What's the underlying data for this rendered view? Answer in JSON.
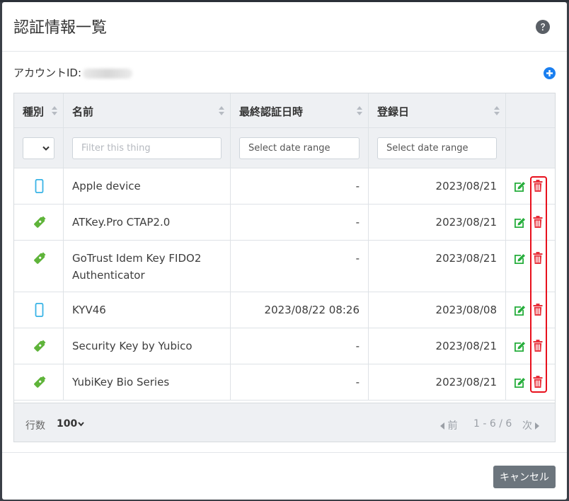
{
  "modal": {
    "title": "認証情報一覧",
    "account_label": "アカウントID:"
  },
  "colors": {
    "accent": "#1a7ff0",
    "edit": "#27ae3d",
    "delete": "#e8303a",
    "device": "#3ab4e6",
    "key": "#5fb43a",
    "highlight": "#e8101c"
  },
  "table": {
    "columns": [
      "種別",
      "名前",
      "最終認証日時",
      "登録日"
    ],
    "filters": {
      "name_placeholder": "Filter this thing",
      "last_auth_placeholder": "Select date range",
      "registered_placeholder": "Select date range"
    },
    "rows": [
      {
        "type": "device",
        "name": "Apple device",
        "last_auth": "-",
        "registered": "2023/08/21"
      },
      {
        "type": "key",
        "name": "ATKey.Pro CTAP2.0",
        "last_auth": "-",
        "registered": "2023/08/21"
      },
      {
        "type": "key",
        "name": "GoTrust Idem Key FIDO2 Authenticator",
        "last_auth": "-",
        "registered": "2023/08/21"
      },
      {
        "type": "device",
        "name": "KYV46",
        "last_auth": "2023/08/22 08:26",
        "registered": "2023/08/08"
      },
      {
        "type": "key",
        "name": "Security Key by Yubico",
        "last_auth": "-",
        "registered": "2023/08/21"
      },
      {
        "type": "key",
        "name": "YubiKey Bio Series",
        "last_auth": "-",
        "registered": "2023/08/21"
      }
    ]
  },
  "footer": {
    "rows_label": "行数",
    "rows_value": "100",
    "prev_label": "前",
    "page_info": "1 - 6 / 6",
    "next_label": "次"
  },
  "buttons": {
    "cancel": "キャンセル"
  }
}
